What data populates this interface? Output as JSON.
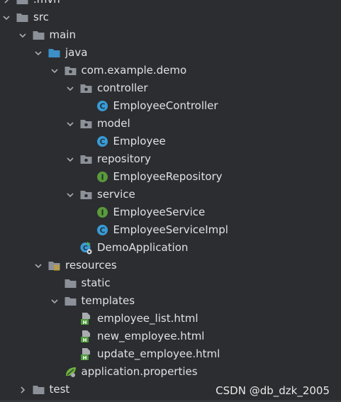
{
  "project_tree": {
    "items": [
      {
        "label": ".mvn",
        "icon": "folder-icon",
        "expand": "chevron-right"
      },
      {
        "label": "src",
        "icon": "folder-icon",
        "expand": "chevron-down"
      },
      {
        "label": "main",
        "icon": "folder-icon",
        "expand": "chevron-down"
      },
      {
        "label": "java",
        "icon": "source-folder-icon",
        "expand": "chevron-down"
      },
      {
        "label": "com.example.demo",
        "icon": "package-icon",
        "expand": "chevron-down"
      },
      {
        "label": "controller",
        "icon": "package-icon",
        "expand": "chevron-down"
      },
      {
        "label": "EmployeeController",
        "icon": "class-icon",
        "expand": "none"
      },
      {
        "label": "model",
        "icon": "package-icon",
        "expand": "chevron-down"
      },
      {
        "label": "Employee",
        "icon": "class-icon",
        "expand": "none"
      },
      {
        "label": "repository",
        "icon": "package-icon",
        "expand": "chevron-down"
      },
      {
        "label": "EmployeeRepository",
        "icon": "interface-icon",
        "expand": "none"
      },
      {
        "label": "service",
        "icon": "package-icon",
        "expand": "chevron-down"
      },
      {
        "label": "EmployeeService",
        "icon": "interface-icon",
        "expand": "none"
      },
      {
        "label": "EmployeeServiceImpl",
        "icon": "class-icon",
        "expand": "none"
      },
      {
        "label": "DemoApplication",
        "icon": "spring-boot-class-icon",
        "expand": "none"
      },
      {
        "label": "resources",
        "icon": "resources-folder-icon",
        "expand": "chevron-down"
      },
      {
        "label": "static",
        "icon": "folder-icon",
        "expand": "none"
      },
      {
        "label": "templates",
        "icon": "folder-icon",
        "expand": "chevron-down"
      },
      {
        "label": "employee_list.html",
        "icon": "html-file-icon",
        "expand": "none"
      },
      {
        "label": "new_employee.html",
        "icon": "html-file-icon",
        "expand": "none"
      },
      {
        "label": "update_employee.html",
        "icon": "html-file-icon",
        "expand": "none"
      },
      {
        "label": "application.properties",
        "icon": "spring-properties-icon",
        "expand": "none"
      },
      {
        "label": "test",
        "icon": "folder-icon",
        "expand": "chevron-right"
      }
    ]
  },
  "watermark": {
    "text": "CSDN @db_dzk_2005"
  },
  "colors": {
    "background": "#2b2d30",
    "text": "#dfe1e5",
    "folder": "#8c9098",
    "source_folder": "#3d8fc7",
    "class_icon": "#3a9bd5",
    "interface_icon": "#5a9a3c",
    "html_icon": "#4d9a3a"
  }
}
